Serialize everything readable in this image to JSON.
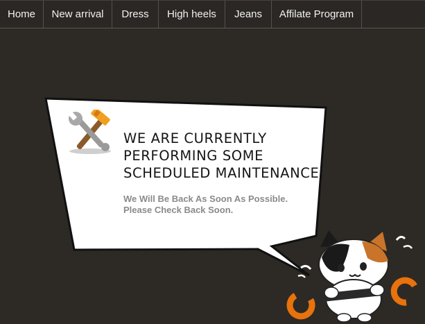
{
  "nav": {
    "items": [
      {
        "label": "Home"
      },
      {
        "label": "New arrival"
      },
      {
        "label": "Dress"
      },
      {
        "label": "High heels"
      },
      {
        "label": "Jeans"
      },
      {
        "label": "Affilate Program"
      }
    ]
  },
  "notice": {
    "headline_line1": "WE ARE CURRENTLY",
    "headline_line2": "PERFORMING SOME",
    "headline_line3": "SCHEDULED MAINTENANCE.",
    "sub_line1": "We Will Be Back As Soon As Possible.",
    "sub_line2": "Please Check Back Soon."
  },
  "icons": {
    "tools": "wrench-and-hammer-icon",
    "mascot": "cat-with-wrench-illustration"
  },
  "colors": {
    "background": "#2d2a26",
    "nav_background": "#2a2724",
    "bubble": "#ffffff",
    "headline": "#151515",
    "subtext": "#8a8a8a",
    "accent_orange": "#e8720c"
  }
}
